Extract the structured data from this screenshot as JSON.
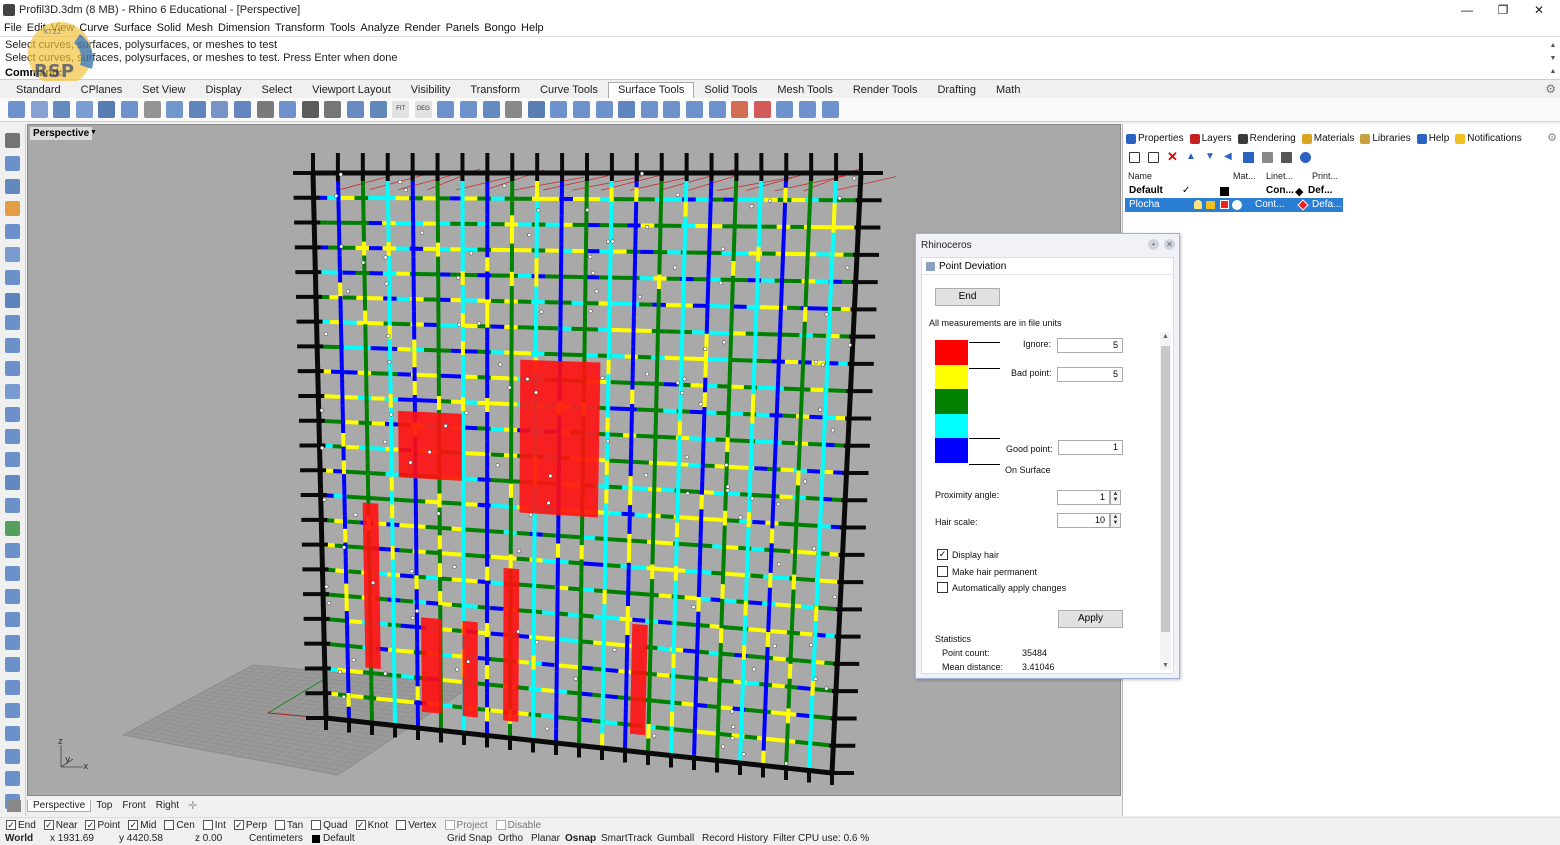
{
  "window": {
    "title": "Profil3D.3dm (8 MB) - Rhino 6 Educational - [Perspective]",
    "controls": [
      "—",
      "❐",
      "✕"
    ]
  },
  "menu": [
    "File",
    "Edit",
    "View",
    "Curve",
    "Surface",
    "Solid",
    "Mesh",
    "Dimension",
    "Transform",
    "Tools",
    "Analyze",
    "Render",
    "Panels",
    "Bongo",
    "Help"
  ],
  "command": {
    "line1": "Select curves, surfaces, polysurfaces, or meshes to test",
    "line2": "Select curves, surfaces, polysurfaces, or meshes to test. Press Enter when done",
    "prompt": "Command:"
  },
  "logo": {
    "text": "RSP",
    "line": "KT22"
  },
  "toolbar_tabs": [
    "Standard",
    "CPlanes",
    "Set View",
    "Display",
    "Select",
    "Viewport Layout",
    "Visibility",
    "Transform",
    "Curve Tools",
    "Surface Tools",
    "Solid Tools",
    "Mesh Tools",
    "Render Tools",
    "Drafting",
    "Math"
  ],
  "active_toolbar_tab": "Surface Tools",
  "toolbar_icon_labels": {
    "fit": "FIT",
    "deg": "DEG"
  },
  "viewport": {
    "label": "Perspective",
    "axes": {
      "z": "z",
      "y": "y",
      "x": "x"
    }
  },
  "viewport_tabs": [
    "Perspective",
    "Top",
    "Front",
    "Right"
  ],
  "osnaps": [
    {
      "label": "End",
      "checked": true
    },
    {
      "label": "Near",
      "checked": true
    },
    {
      "label": "Point",
      "checked": true
    },
    {
      "label": "Mid",
      "checked": true
    },
    {
      "label": "Cen",
      "checked": false
    },
    {
      "label": "Int",
      "checked": false
    },
    {
      "label": "Perp",
      "checked": true
    },
    {
      "label": "Tan",
      "checked": false
    },
    {
      "label": "Quad",
      "checked": false
    },
    {
      "label": "Knot",
      "checked": true
    },
    {
      "label": "Vertex",
      "checked": false
    },
    {
      "label": "Project",
      "checked": false,
      "dim": true
    },
    {
      "label": "Disable",
      "checked": false,
      "dim": true
    }
  ],
  "status": {
    "cplane": "World",
    "x": "x 1931.69",
    "y": "y 4420.58",
    "z": "z 0.00",
    "units": "Centimeters",
    "layer": "Default",
    "grid_snap": "Grid Snap",
    "ortho": "Ortho",
    "planar": "Planar",
    "osnap": "Osnap",
    "smarttrack": "SmartTrack",
    "gumball": "Gumball",
    "record_history": "Record History",
    "filter": "Filter",
    "cpu": "CPU use: 0.6 %"
  },
  "panel": {
    "tabs": [
      "Properties",
      "Layers",
      "Rendering",
      "Materials",
      "Libraries",
      "Help",
      "Notifications"
    ],
    "columns": {
      "name": "Name",
      "material": "Mat...",
      "linetype": "Linet...",
      "print": "Print..."
    },
    "layers": [
      {
        "name": "Default",
        "current": "✓",
        "linetype": "Con...",
        "print": "Def..."
      },
      {
        "name": "Plocha",
        "current": "",
        "linetype": "Cont...",
        "print": "Defa..."
      }
    ]
  },
  "dialog": {
    "title": "Rhinoceros",
    "pane": "Point Deviation",
    "end_button": "End",
    "units_note": "All measurements are in file units",
    "ignore_label": "Ignore:",
    "ignore_value": "5",
    "bad_label": "Bad point:",
    "bad_value": "5",
    "good_label": "Good point:",
    "good_value": "1",
    "on_surface": "On Surface",
    "proximity_label": "Proximity angle:",
    "proximity_value": "1",
    "hair_label": "Hair scale:",
    "hair_value": "10",
    "options": [
      {
        "label": "Display hair",
        "checked": true
      },
      {
        "label": "Make hair permanent",
        "checked": false
      },
      {
        "label": "Automatically apply changes",
        "checked": false
      }
    ],
    "apply_button": "Apply",
    "stats_title": "Statistics",
    "point_count_label": "Point count:",
    "point_count": "35484",
    "mean_label": "Mean distance:",
    "mean_value": "3.41046",
    "deviation_colors": [
      "#ff0000",
      "#ffff00",
      "#008000",
      "#00ffff",
      "#0000ff"
    ]
  },
  "colors": {
    "viewport_bg": "#a9a9a9",
    "selection": "#2a7fd4",
    "dialog_border": "#9db3d6"
  }
}
